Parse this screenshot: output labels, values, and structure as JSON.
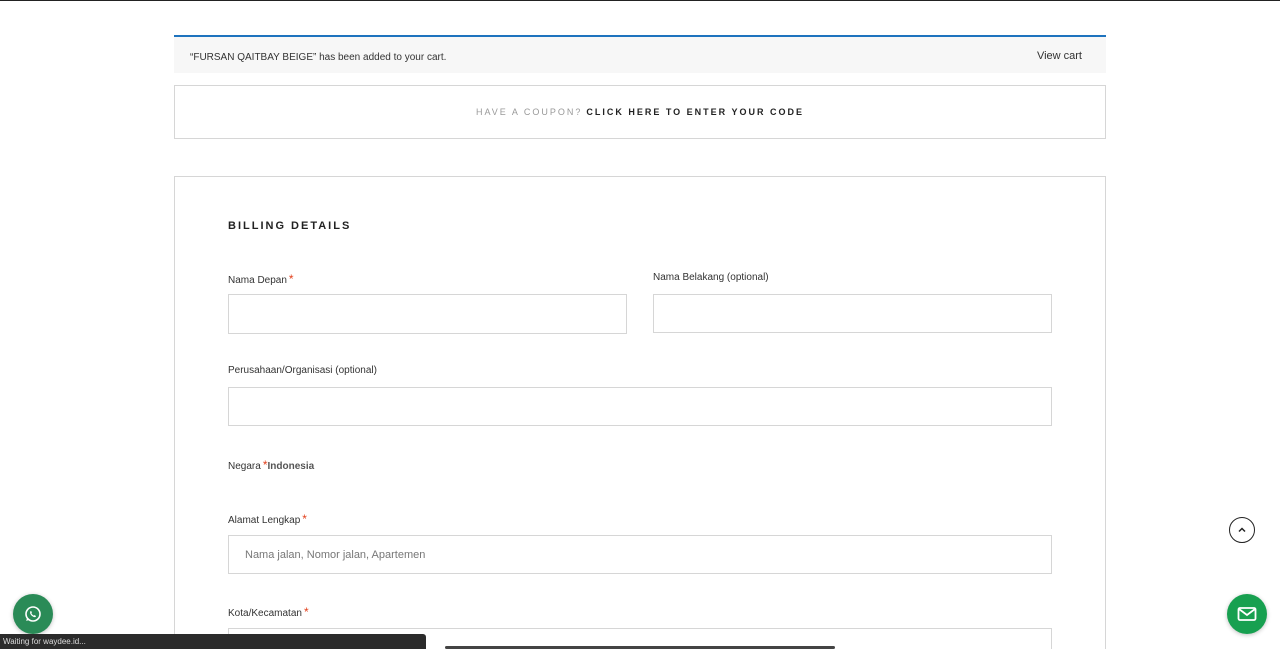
{
  "notice": {
    "message": "“FURSAN QAITBAY BEIGE” has been added to your cart.",
    "view_cart": "View cart"
  },
  "coupon": {
    "question": "HAVE A COUPON?",
    "link": "CLICK HERE TO ENTER YOUR CODE"
  },
  "billing": {
    "title": "BILLING DETAILS",
    "first_name_label": "Nama Depan",
    "last_name_label": "Nama Belakang (optional)",
    "company_label": "Perusahaan/Organisasi (optional)",
    "country_label": "Negara",
    "country_value": "Indonesia",
    "address_label": "Alamat Lengkap",
    "address_placeholder": "Nama jalan, Nomor jalan, Apartemen",
    "city_label": "Kota/Kecamatan",
    "required_mark": "*"
  },
  "status_bar": {
    "text": "Waiting for waydee.id..."
  },
  "icons": {
    "scroll_top": "chevron-up-icon",
    "whatsapp": "whatsapp-icon",
    "mail": "mail-icon"
  },
  "colors": {
    "accent": "#1e73be",
    "required": "#e2401c",
    "whatsapp": "#2a8b57",
    "mail": "#17a050"
  }
}
